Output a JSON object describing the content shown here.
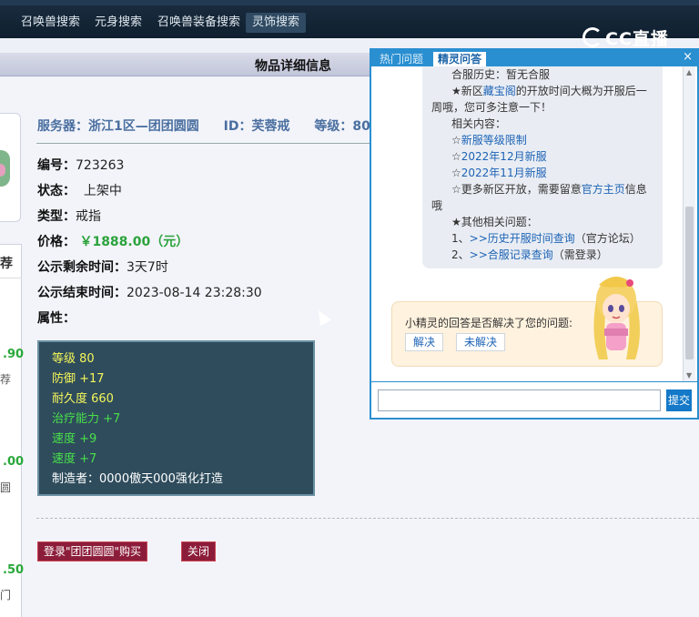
{
  "nav": {
    "tabs": [
      "召唤兽搜索",
      "元身搜索",
      "召唤兽装备搜索",
      "灵饰搜索"
    ],
    "logo_text": "CC直播"
  },
  "page": {
    "title": "物品详细信息"
  },
  "item": {
    "server_label": "服务器：浙江1区—团团圆圆",
    "id_label": "ID：芙蓉戒",
    "level_label": "等级：80",
    "number_label": "编号：",
    "number": "723263",
    "status_label": "状态：",
    "status": "上架中",
    "type_label": "类型：",
    "type": "戒指",
    "price_label": "价格：",
    "price": "￥1888.00（元）",
    "remain_label": "公示剩余时间：",
    "remain": "3天7时",
    "end_label": "公示结束时间：",
    "end": "2023-08-14 23:28:30",
    "attr_label": "属性："
  },
  "attributes": {
    "line1": "等级 80",
    "line2": "防御 +17",
    "line3": "耐久度 660",
    "line4": "治疗能力 +7",
    "line5": "速度 +9",
    "line6": "速度 +7",
    "line7": "制造者：0000傲天000强化打造"
  },
  "buttons": {
    "buy": "登录\"团团圆圆\"购买",
    "close": "关闭"
  },
  "sidebar": {
    "header": "荐",
    "price1": ".90",
    "price2": ".00",
    "price3": ".50",
    "note1": "荐",
    "note2": "圆",
    "note3": "门"
  },
  "chat": {
    "tab_hot": "热门问题",
    "tab_qa": "精灵问答",
    "close": "×",
    "history": "合服历史：暂无合服",
    "news_pre": "★新区",
    "news_link": "藏宝阁",
    "news_post": "的开放时间大概为开服后一",
    "news_wrap": "周哦，您可多注意一下！",
    "related": "相关内容：",
    "r1_star": "☆",
    "r1": "新服等级限制",
    "r2_star": "☆",
    "r2": "2022年12月新服",
    "r3_star": "☆",
    "r3": "2022年11月新服",
    "r4_pre": "☆更多新区开放，需要留意",
    "r4_link": "官方主页",
    "r4_post": "信息",
    "r4_wrap": "哦",
    "other": "★其他相关问题：",
    "o1_num": "1、",
    "o1_link": ">>历史开服时间查询",
    "o1_tail": "（官方论坛）",
    "o2_num": "2、",
    "o2_link": ">>合服记录查询",
    "o2_tail": "（需登录）",
    "question": "小精灵的回答是否解决了您的问题:",
    "solved": "解决",
    "unsolved": "未解决",
    "input_placeholder": "",
    "send": "提交"
  }
}
